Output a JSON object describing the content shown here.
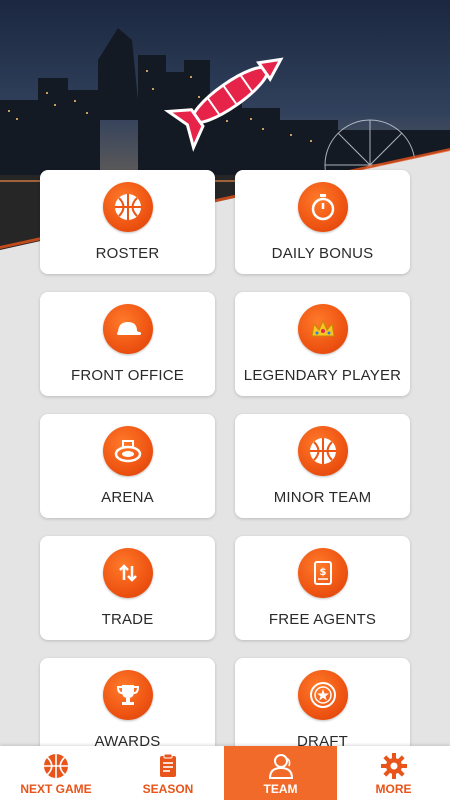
{
  "colors": {
    "accent": "#ee5412",
    "card_bg": "#ffffff",
    "page_bg": "#e4e4e4",
    "active_tab": "#f26a2a"
  },
  "menu": {
    "items": [
      {
        "label": "ROSTER",
        "icon": "basketball-icon"
      },
      {
        "label": "DAILY BONUS",
        "icon": "stopwatch-icon"
      },
      {
        "label": "FRONT OFFICE",
        "icon": "cap-icon"
      },
      {
        "label": "LEGENDARY PLAYER",
        "icon": "crown-icon"
      },
      {
        "label": "ARENA",
        "icon": "arena-icon"
      },
      {
        "label": "MINOR TEAM",
        "icon": "basketball-icon"
      },
      {
        "label": "TRADE",
        "icon": "trade-arrows-icon"
      },
      {
        "label": "FREE AGENTS",
        "icon": "contract-icon"
      },
      {
        "label": "AWARDS",
        "icon": "trophy-icon"
      },
      {
        "label": "DRAFT",
        "icon": "draft-seal-icon"
      }
    ]
  },
  "tabs": [
    {
      "label": "NEXT GAME",
      "icon": "basketball-icon",
      "active": false
    },
    {
      "label": "SEASON",
      "icon": "clipboard-icon",
      "active": false
    },
    {
      "label": "TEAM",
      "icon": "team-person-icon",
      "active": true
    },
    {
      "label": "MORE",
      "icon": "gear-icon",
      "active": false
    }
  ]
}
